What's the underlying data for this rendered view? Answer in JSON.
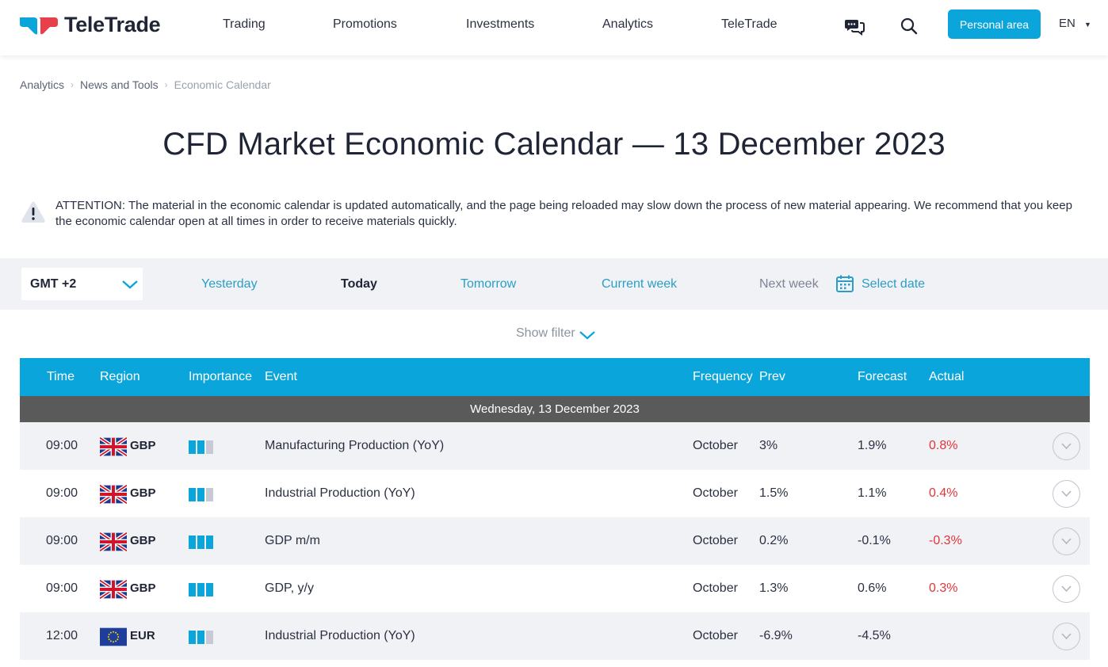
{
  "header": {
    "brand": "TeleTrade",
    "nav": [
      "Trading",
      "Promotions",
      "Investments",
      "Analytics",
      "TeleTrade"
    ],
    "personal_area": "Personal area",
    "language": "EN",
    "icons": [
      "chat-icon",
      "search-icon"
    ]
  },
  "breadcrumb": [
    "Analytics",
    "News and Tools",
    "Economic Calendar"
  ],
  "page_title": "CFD Market Economic Calendar — 13 December 2023",
  "attention_text": "ATTENTION: The material in the economic calendar is updated automatically, and the page being reloaded may slow down the process of new material appearing. We recommend that you keep the economic calendar open at all times in order to receive materials quickly.",
  "filters": {
    "timezone": "GMT +2",
    "periods": [
      "Yesterday",
      "Today",
      "Tomorrow",
      "Current week",
      "Next week"
    ],
    "active_period": "Today",
    "select_date": "Select date",
    "show_filter": "Show filter"
  },
  "table": {
    "columns": [
      "Time",
      "Region",
      "Importance",
      "Event",
      "Frequency",
      "Prev",
      "Forecast",
      "Actual"
    ],
    "day": "Wednesday, 13 December 2023",
    "rows": [
      {
        "time": "09:00",
        "currency": "GBP",
        "flag": "uk-flag",
        "importance": 2,
        "event": "Manufacturing Production (YoY)",
        "frequency": "October",
        "prev": "3%",
        "forecast": "1.9%",
        "actual": "0.8%"
      },
      {
        "time": "09:00",
        "currency": "GBP",
        "flag": "uk-flag",
        "importance": 2,
        "event": "Industrial Production (YoY)",
        "frequency": "October",
        "prev": "1.5%",
        "forecast": "1.1%",
        "actual": "0.4%"
      },
      {
        "time": "09:00",
        "currency": "GBP",
        "flag": "uk-flag",
        "importance": 3,
        "event": "GDP m/m",
        "frequency": "October",
        "prev": "0.2%",
        "forecast": "-0.1%",
        "actual": "-0.3%"
      },
      {
        "time": "09:00",
        "currency": "GBP",
        "flag": "uk-flag",
        "importance": 3,
        "event": "GDP, y/y",
        "frequency": "October",
        "prev": "1.3%",
        "forecast": "0.6%",
        "actual": "0.3%"
      },
      {
        "time": "12:00",
        "currency": "EUR",
        "flag": "eu-flag",
        "importance": 2,
        "event": "Industrial Production (YoY)",
        "frequency": "October",
        "prev": "-6.9%",
        "forecast": "-4.5%",
        "actual": ""
      }
    ]
  },
  "colors": {
    "accent": "#0aa5db",
    "link": "#2a9ec7",
    "actual_negative": "#e0353b",
    "day_row": "#5a5a5a"
  }
}
